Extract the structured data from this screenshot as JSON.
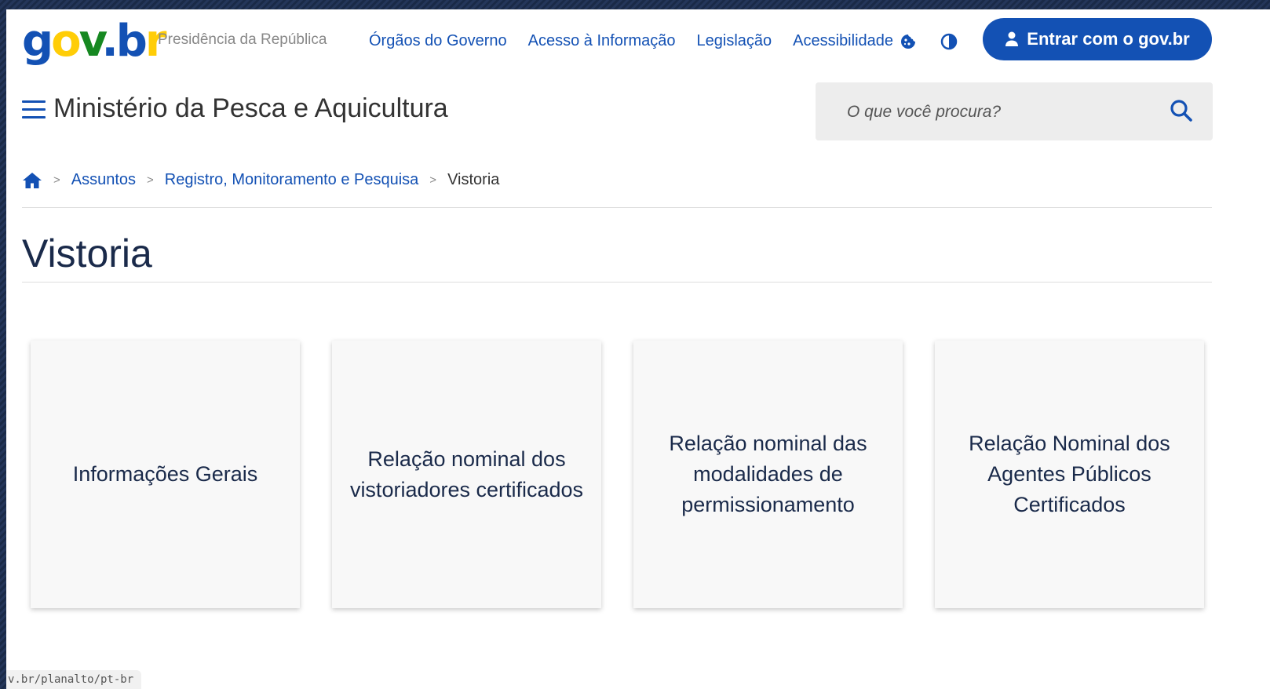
{
  "header": {
    "logo": {
      "g": "g",
      "o": "o",
      "v": "v",
      "dot": ".",
      "b": "b",
      "r": "r"
    },
    "presidencia": "Presidência da República",
    "nav": [
      "Órgãos do Governo",
      "Acesso à Informação",
      "Legislação",
      "Acessibilidade"
    ],
    "icons": [
      "cookie-icon",
      "contrast-icon"
    ],
    "login_label": "Entrar com o gov.br"
  },
  "site": {
    "title": "Ministério da Pesca e Aquicultura",
    "search_placeholder": "O que você procura?"
  },
  "breadcrumb": {
    "sep": ">",
    "items": [
      "Assuntos",
      "Registro, Monitoramento e Pesquisa"
    ],
    "current": "Vistoria"
  },
  "page": {
    "title": "Vistoria",
    "cards": [
      "Informações Gerais",
      "Relação nominal dos vistoriadores certificados",
      "Relação nominal das modalidades de permissionamento",
      "Relação Nominal dos Agentes Públicos Certificados"
    ]
  },
  "statusbar": {
    "url": "v.br/planalto/pt-br"
  },
  "colors": {
    "primary": "#1351b4",
    "yellow": "#ffcd07",
    "green": "#168821"
  }
}
